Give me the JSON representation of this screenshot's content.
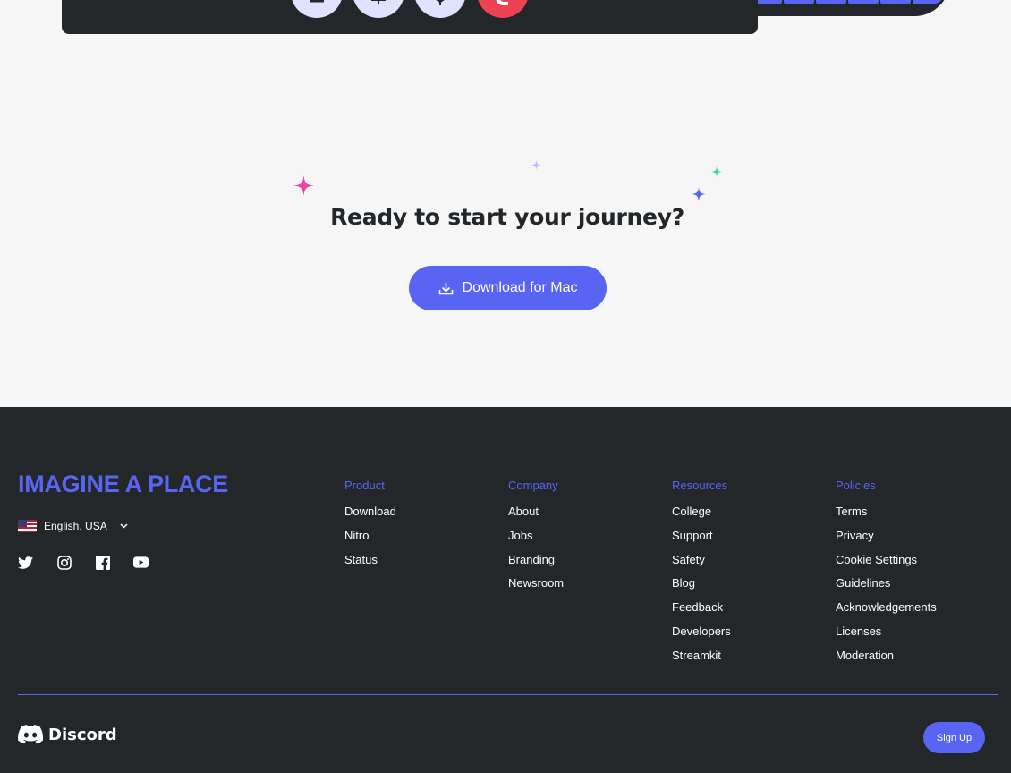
{
  "cta": {
    "title": "Ready to start your journey?",
    "download_label": "Download for Mac"
  },
  "footer": {
    "tagline": "IMAGINE A PLACE",
    "language": "English, USA",
    "socials": [
      "twitter-icon",
      "instagram-icon",
      "facebook-icon",
      "youtube-icon"
    ],
    "columns": [
      {
        "heading": "Product",
        "links": [
          "Download",
          "Nitro",
          "Status"
        ]
      },
      {
        "heading": "Company",
        "links": [
          "About",
          "Jobs",
          "Branding",
          "Newsroom"
        ]
      },
      {
        "heading": "Resources",
        "links": [
          "College",
          "Support",
          "Safety",
          "Blog",
          "Feedback",
          "Developers",
          "Streamkit"
        ]
      },
      {
        "heading": "Policies",
        "links": [
          "Terms",
          "Privacy",
          "Cookie Settings",
          "Guidelines",
          "Acknowledgements",
          "Licenses",
          "Moderation"
        ]
      }
    ],
    "brand": "Discord",
    "signup_label": "Sign Up"
  },
  "colors": {
    "brand": "#5865f2",
    "dark": "#23272a",
    "danger": "#ed4254"
  }
}
